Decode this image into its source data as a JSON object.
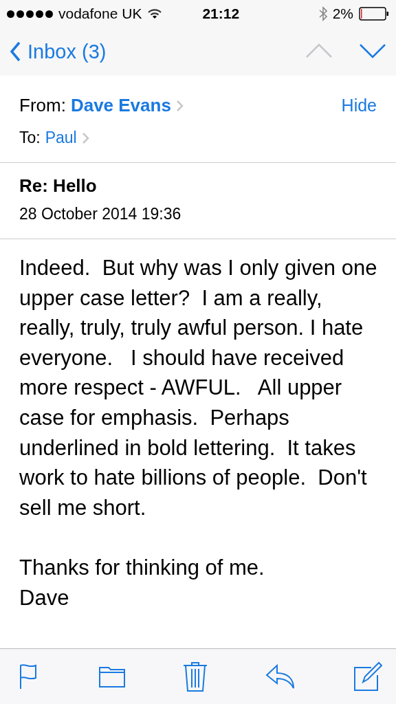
{
  "status_bar": {
    "carrier": "vodafone UK",
    "time": "21:12",
    "battery": "2%"
  },
  "nav": {
    "back": "Inbox (3)",
    "previous_disabled": true,
    "next_disabled": false
  },
  "header": {
    "from_label": "From:",
    "from": "Dave Evans",
    "hide": "Hide",
    "to_label": "To:",
    "to": "Paul"
  },
  "subject": "Re: Hello",
  "date": "28 October 2014 19:36",
  "body": [
    "Indeed.  But why was I only given one upper case letter?  I am a really, really, truly, truly awful person. I hate everyone.   I should have received more respect - AWFUL.   All upper case for emphasis.  Perhaps underlined in bold lettering.  It takes work to hate billions of people.  Don't sell me short.",
    "Thanks for thinking of me.",
    "Dave"
  ]
}
